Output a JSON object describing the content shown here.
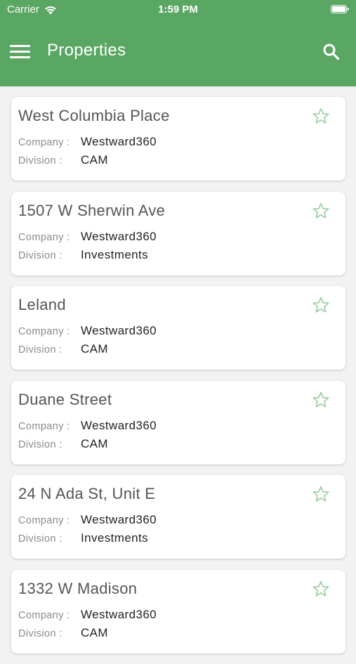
{
  "status_bar": {
    "carrier": "Carrier",
    "time": "1:59 PM",
    "wifi_icon": "wifi-icon",
    "battery_icon": "battery-icon"
  },
  "app_bar": {
    "title": "Properties",
    "menu_icon": "hamburger-menu-icon",
    "search_icon": "search-icon",
    "background_color": "#5aa764"
  },
  "labels": {
    "company": "Company :",
    "division": "Division :"
  },
  "properties": [
    {
      "name": "West Columbia Place",
      "company": "Westward360",
      "division": "CAM"
    },
    {
      "name": "1507 W Sherwin Ave",
      "company": "Westward360",
      "division": "Investments"
    },
    {
      "name": "Leland",
      "company": "Westward360",
      "division": "CAM"
    },
    {
      "name": "Duane Street",
      "company": "Westward360",
      "division": "CAM"
    },
    {
      "name": "24 N Ada St, Unit E",
      "company": "Westward360",
      "division": "Investments"
    },
    {
      "name": "1332 W Madison",
      "company": "Westward360",
      "division": "CAM"
    }
  ],
  "favorite_icon": "star-outline-icon",
  "favorite_icon_color": "#9fcfa6"
}
